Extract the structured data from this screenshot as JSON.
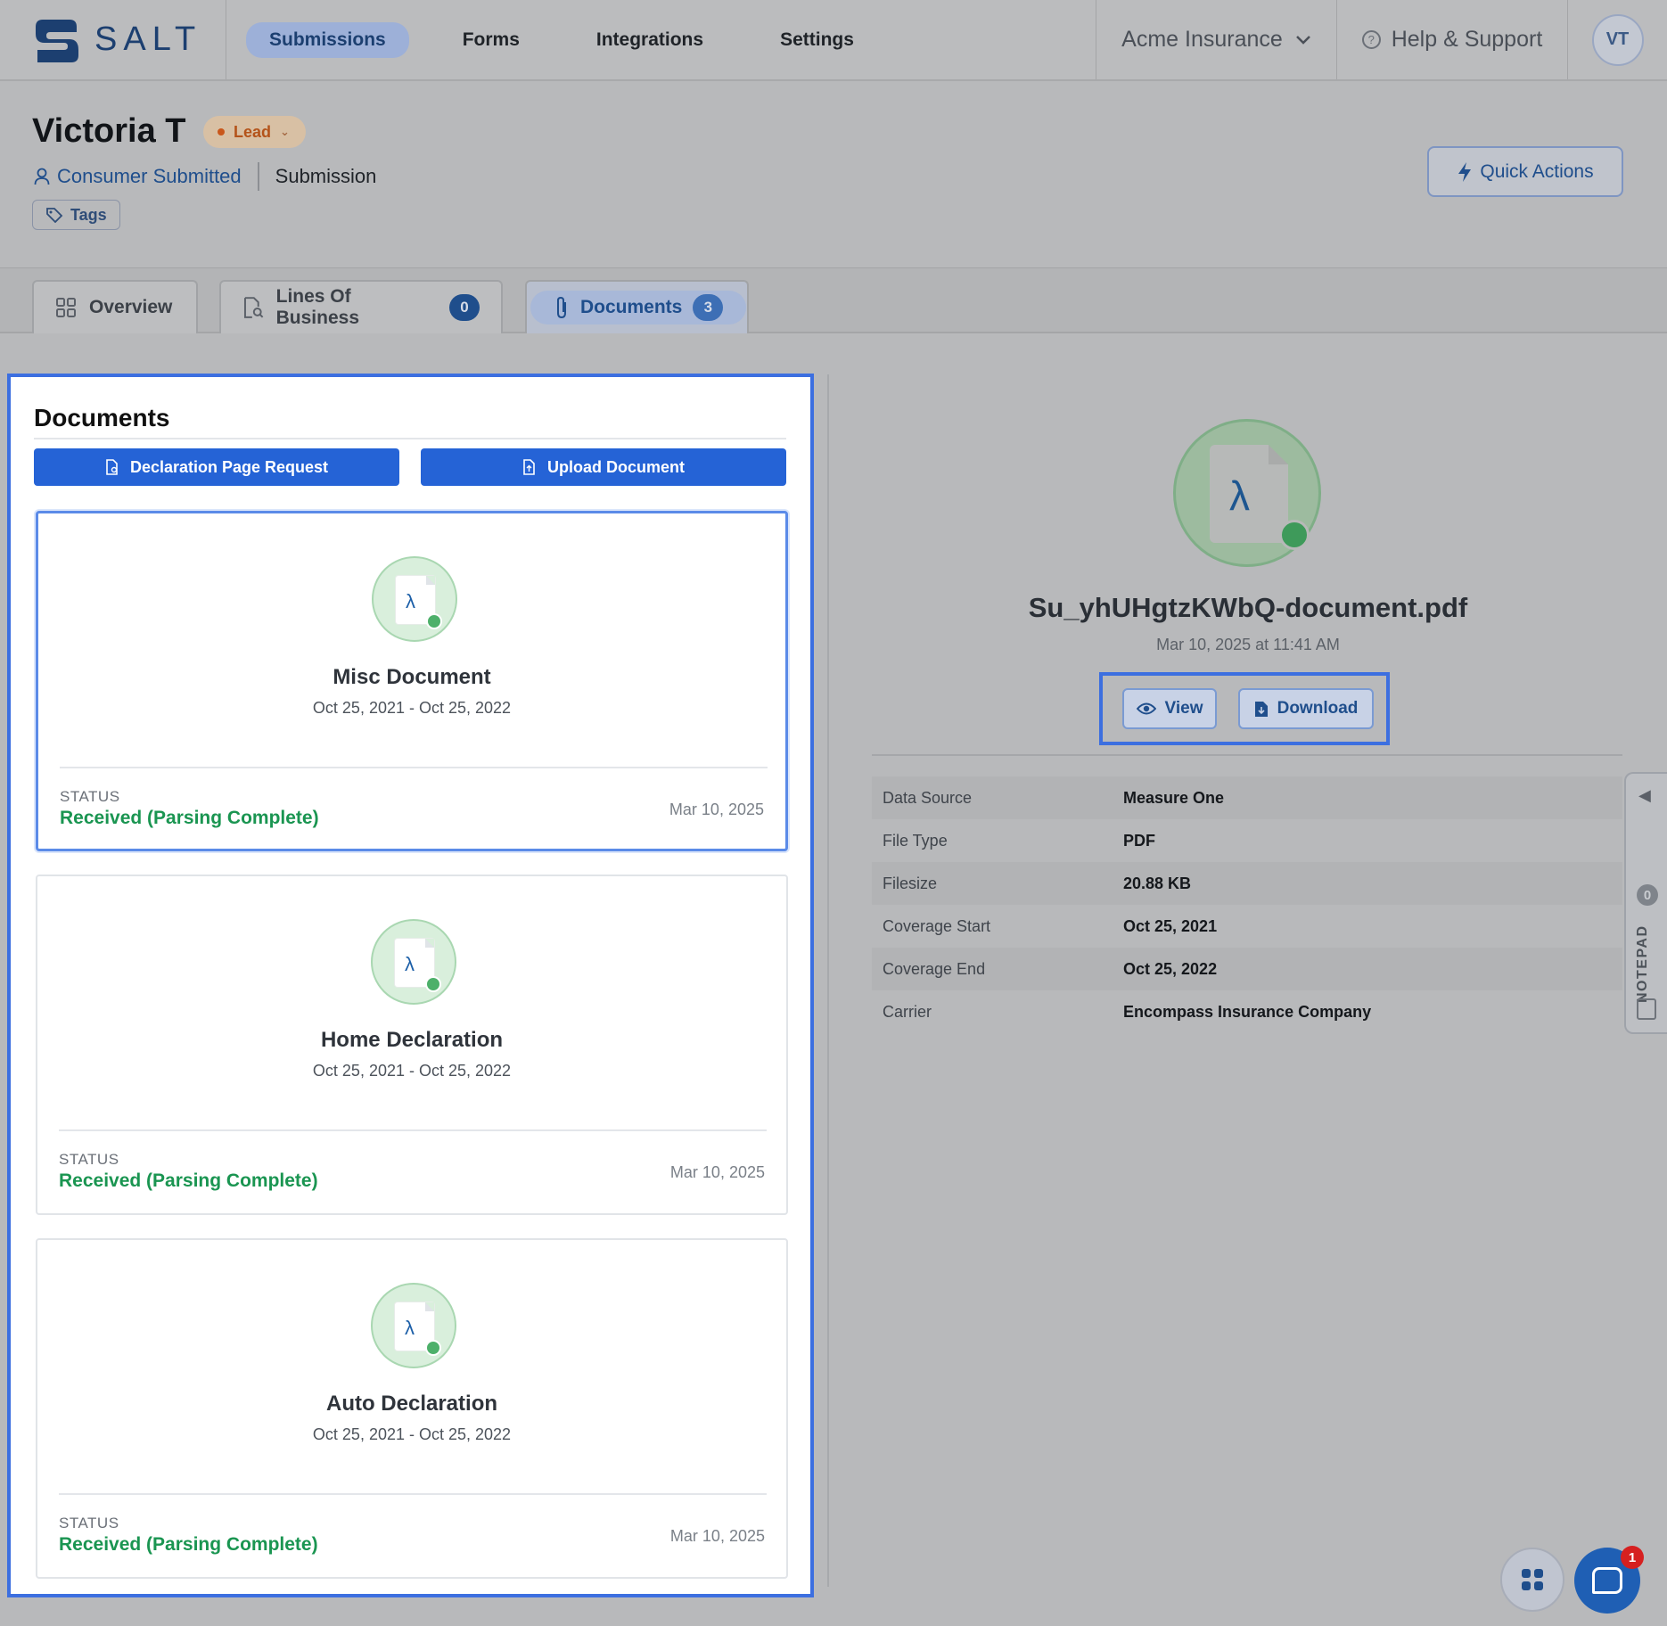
{
  "nav": {
    "logo_text": "SALT",
    "tabs": [
      {
        "label": "Submissions",
        "active": true
      },
      {
        "label": "Forms"
      },
      {
        "label": "Integrations"
      },
      {
        "label": "Settings"
      }
    ],
    "org": "Acme Insurance",
    "help": "Help & Support",
    "avatar_initials": "VT"
  },
  "header": {
    "name": "Victoria T",
    "status_badge": "Lead",
    "source": "Consumer Submitted",
    "type": "Submission",
    "tags_label": "Tags",
    "quick_actions": "Quick Actions"
  },
  "tabs": [
    {
      "label": "Overview"
    },
    {
      "label": "Lines Of Business",
      "count": "0"
    },
    {
      "label": "Documents",
      "count": "3",
      "active": true
    }
  ],
  "documents": {
    "title": "Documents",
    "declaration_request": "Declaration Page Request",
    "upload": "Upload Document",
    "status_label": "STATUS",
    "items": [
      {
        "name": "Misc Document",
        "range": "Oct 25, 2021 - Oct 25, 2022",
        "status": "Received (Parsing Complete)",
        "date": "Mar 10, 2025",
        "selected": true
      },
      {
        "name": "Home Declaration",
        "range": "Oct 25, 2021 - Oct 25, 2022",
        "status": "Received (Parsing Complete)",
        "date": "Mar 10, 2025"
      },
      {
        "name": "Auto Declaration",
        "range": "Oct 25, 2021 - Oct 25, 2022",
        "status": "Received (Parsing Complete)",
        "date": "Mar 10, 2025"
      }
    ]
  },
  "detail": {
    "filename": "Su_yhUHgtzKWbQ-document.pdf",
    "uploaded": "Mar 10, 2025 at 11:41 AM",
    "view": "View",
    "download": "Download",
    "props": [
      {
        "key": "Data Source",
        "value": "Measure One"
      },
      {
        "key": "File Type",
        "value": "PDF"
      },
      {
        "key": "Filesize",
        "value": "20.88 KB"
      },
      {
        "key": "Coverage Start",
        "value": "Oct 25, 2021"
      },
      {
        "key": "Coverage End",
        "value": "Oct 25, 2022"
      },
      {
        "key": "Carrier",
        "value": "Encompass Insurance Company"
      }
    ]
  },
  "notepad": {
    "label": "NOTEPAD",
    "count": "0"
  },
  "chat": {
    "unread": "1"
  },
  "colors": {
    "primary": "#2563d6",
    "brand": "#1c3f70",
    "success": "#1a9551",
    "selection": "#3c6fe0"
  }
}
